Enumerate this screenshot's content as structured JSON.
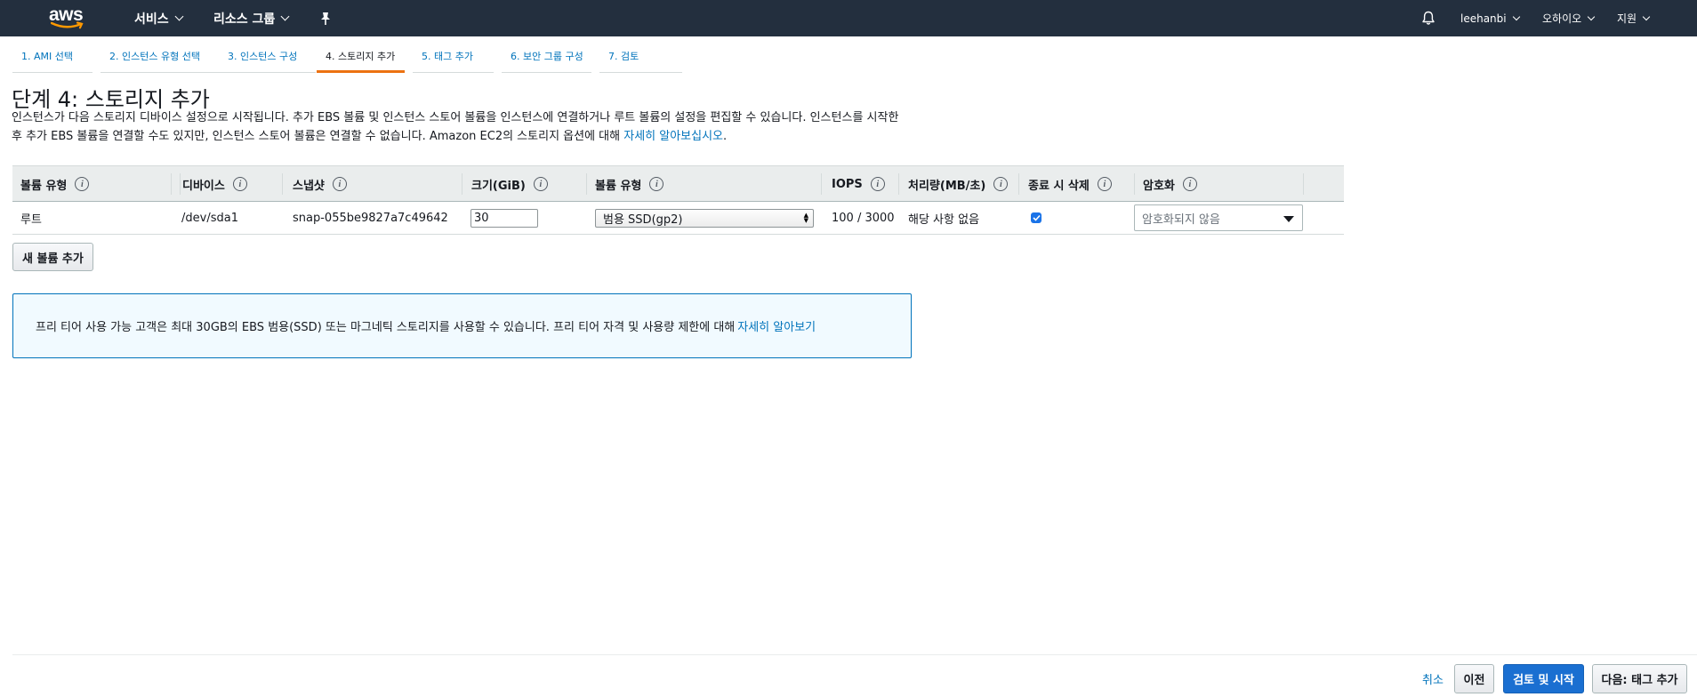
{
  "nav": {
    "logo_text": "aws",
    "services": "서비스",
    "resource_groups": "리소스 그룹",
    "user": "leehanbi",
    "region": "오하이오",
    "support": "지원"
  },
  "steps": [
    {
      "label": "1. AMI 선택",
      "active": false
    },
    {
      "label": "2. 인스턴스 유형 선택",
      "active": false
    },
    {
      "label": "3. 인스턴스 구성",
      "active": false
    },
    {
      "label": "4. 스토리지 추가",
      "active": true
    },
    {
      "label": "5. 태그 추가",
      "active": false
    },
    {
      "label": "6. 보안 그룹 구성",
      "active": false
    },
    {
      "label": "7. 검토",
      "active": false
    }
  ],
  "page": {
    "title": "단계 4: 스토리지 추가",
    "desc_1": "인스턴스가 다음 스토리지 디바이스 설정으로 시작됩니다. 추가 EBS 볼륨 및 인스턴스 스토어 볼륨을 인스턴스에 연결하거나 루트 볼륨의 설정을 편집할 수 있습니다. 인스턴스를 시작한",
    "desc_2": "후 추가 EBS 볼륨을 연결할 수도 있지만, 인스턴스 스토어 볼륨은 연결할 수 없습니다. Amazon EC2의 스토리지 옵션에 대해 ",
    "desc_link": "자세히 알아보십시오",
    "desc_end": "."
  },
  "table": {
    "headers": [
      "볼륨 유형",
      "디바이스",
      "스냅샷",
      "크기(GiB)",
      "볼륨 유형",
      "IOPS",
      "처리량(MB/초)",
      "종료 시 삭제",
      "암호화"
    ],
    "info_glyph": "i",
    "row": {
      "volume_kind": "루트",
      "device": "/dev/sda1",
      "snapshot": "snap-055be9827a7c49642",
      "size": "30",
      "volume_type": "범용 SSD(gp2)",
      "iops": "100 / 3000",
      "throughput": "해당 사항 없음",
      "delete_on_termination": true,
      "encryption": "암호화되지 않음"
    }
  },
  "add_volume_label": "새 볼륨 추가",
  "info_box": {
    "text": "프리 티어 사용 가능 고객은 최대 30GB의 EBS 범용(SSD) 또는 마그네틱 스토리지를 사용할 수 있습니다. 프리 티어 자격 및 사용량 제한에 대해 ",
    "link": "자세히 알아보기"
  },
  "footer": {
    "cancel": "취소",
    "previous": "이전",
    "review_launch": "검토 및 시작",
    "next": "다음: 태그 추가"
  },
  "colors": {
    "nav_bg": "#232f3e",
    "link": "#0073bb",
    "active_step": "#ec7211",
    "primary_button": "#1a6fd1"
  }
}
